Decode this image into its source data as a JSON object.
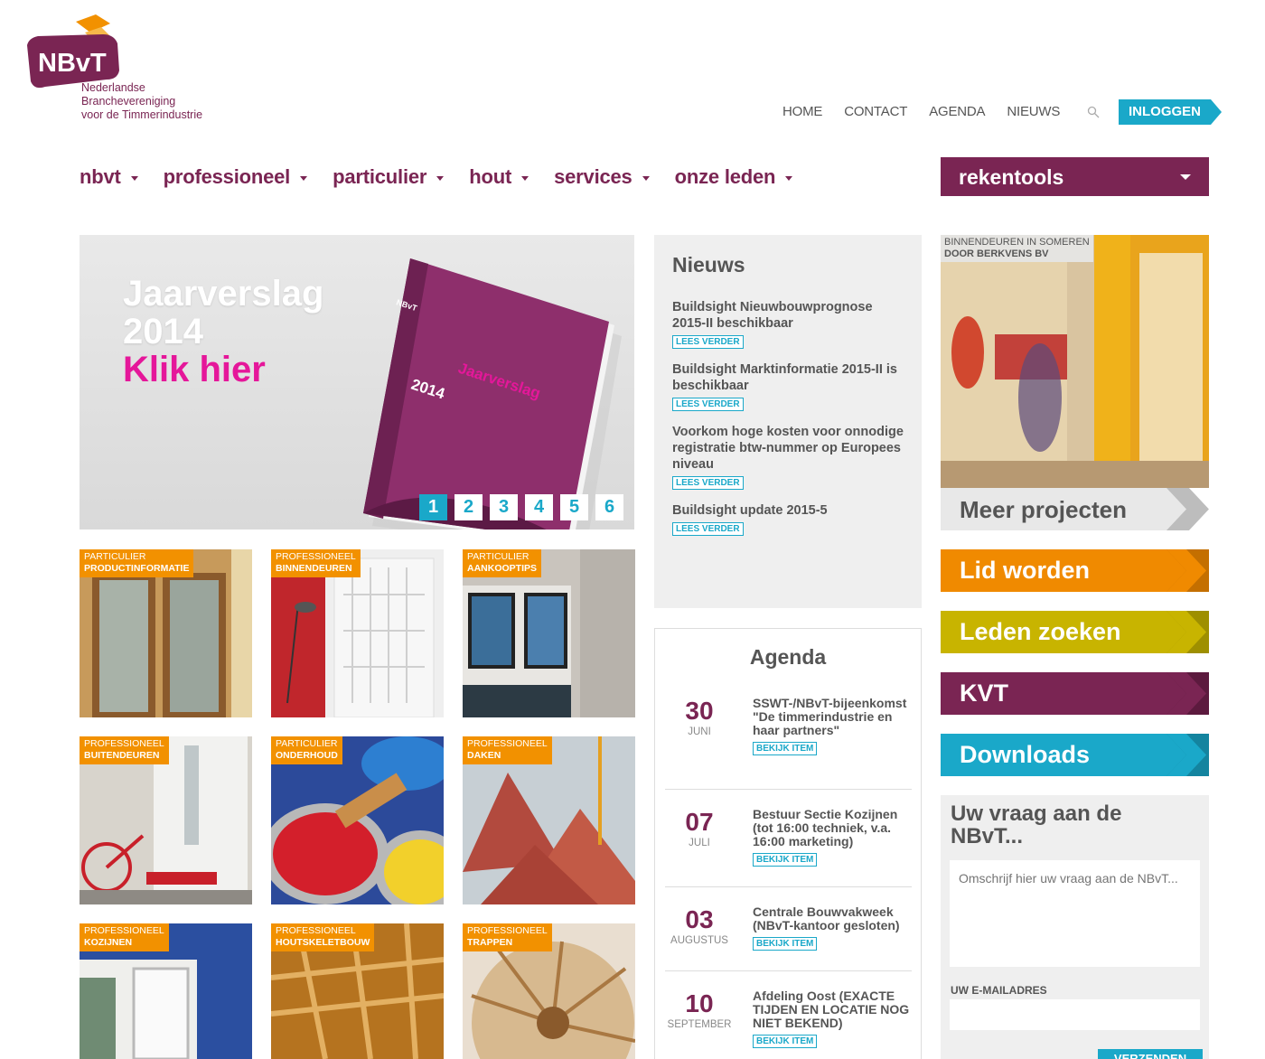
{
  "logo": {
    "abbr": "NBvT",
    "line1": "Nederlandse",
    "line2": "Branchevereniging",
    "line3": "voor de Timmerindustrie"
  },
  "topnav": {
    "home": "HOME",
    "contact": "CONTACT",
    "agenda": "AGENDA",
    "nieuws": "NIEUWS",
    "login": "INLOGGEN"
  },
  "mainnav": [
    "nbvt",
    "professioneel",
    "particulier",
    "hout",
    "services",
    "onze leden"
  ],
  "rekentools": "rekentools",
  "slider": {
    "line1": "Jaarverslag",
    "line2": "2014",
    "line3": "Klik hier",
    "book_title": "Jaarverslag",
    "book_year": "2014",
    "book_logo": "NBvT",
    "pages": [
      "1",
      "2",
      "3",
      "4",
      "5",
      "6"
    ],
    "active_page": 1
  },
  "tiles": [
    {
      "cat": "PARTICULIER",
      "title": "PRODUCTINFORMATIE"
    },
    {
      "cat": "PROFESSIONEEL",
      "title": "BINNENDEUREN"
    },
    {
      "cat": "PARTICULIER",
      "title": "AANKOOPTIPS"
    },
    {
      "cat": "PROFESSIONEEL",
      "title": "BUITENDEUREN"
    },
    {
      "cat": "PARTICULIER",
      "title": "ONDERHOUD"
    },
    {
      "cat": "PROFESSIONEEL",
      "title": "DAKEN"
    },
    {
      "cat": "PROFESSIONEEL",
      "title": "KOZIJNEN"
    },
    {
      "cat": "PROFESSIONEEL",
      "title": "HOUTSKELETBOUW"
    },
    {
      "cat": "PROFESSIONEEL",
      "title": "TRAPPEN"
    }
  ],
  "nieuws": {
    "heading": "Nieuws",
    "read_more": "LEES VERDER",
    "items": [
      "Buildsight Nieuwbouwprognose 2015-II beschikbaar",
      "Buildsight Marktinformatie 2015-II is beschikbaar",
      "Voorkom hoge kosten voor onnodige registratie btw-nummer op Europees niveau",
      "Buildsight update 2015-5"
    ]
  },
  "agenda": {
    "heading": "Agenda",
    "view": "BEKIJK ITEM",
    "items": [
      {
        "day": "30",
        "month": "JUNI",
        "text": "SSWT-/NBvT-bijeenkomst \"De timmerindustrie en haar partners\""
      },
      {
        "day": "07",
        "month": "JULI",
        "text": "Bestuur Sectie Kozijnen (tot 16:00 techniek, v.a. 16:00 marketing)"
      },
      {
        "day": "03",
        "month": "AUGUSTUS",
        "text": "Centrale Bouwvakweek (NBvT-kantoor gesloten)"
      },
      {
        "day": "10",
        "month": "SEPTEMBER",
        "text": "Afdeling Oost (EXACTE TIJDEN EN LOCATIE NOG NIET BEKEND)"
      }
    ]
  },
  "project": {
    "caption1": "BINNENDEUREN IN SOMEREN",
    "caption2": "DOOR BERKVENS BV",
    "more": "Meer projecten"
  },
  "cta": [
    {
      "label": "Lid worden",
      "color": "#f08a00",
      "tip": "#c46f00"
    },
    {
      "label": "Leden zoeken",
      "color": "#c8b400",
      "tip": "#9e8f00"
    },
    {
      "label": "KVT",
      "color": "#7a2553",
      "tip": "#5c1a3e"
    },
    {
      "label": "Downloads",
      "color": "#1aa8c9",
      "tip": "#14849f"
    }
  ],
  "vraag": {
    "heading": "Uw vraag aan de NBvT...",
    "placeholder": "Omschrijf hier uw vraag aan de NBvT...",
    "email_label": "UW E-MAILADRES",
    "send": "VERZENDEN"
  },
  "colors": {
    "brand_purple": "#7a2553",
    "accent_cyan": "#1aa8c9",
    "accent_orange": "#f29100",
    "slider_pink": "#e5179a"
  }
}
